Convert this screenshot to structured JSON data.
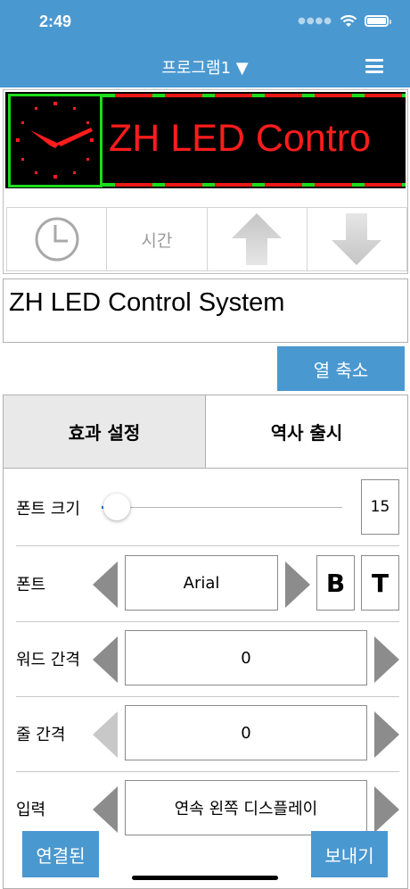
{
  "status_bar": {
    "time": "2:49",
    "signal_icon": "signal-dots-icon",
    "wifi_icon": "wifi-icon",
    "battery_icon": "battery-icon"
  },
  "nav": {
    "title": "프로그램1 ▼",
    "menu_icon": "hamburger-menu-icon"
  },
  "led_preview": {
    "text": "ZH LED Contro",
    "text_color": "#ff1c1c",
    "frame_color": "#1cdc1c"
  },
  "toolbar": {
    "clock_icon": "clock-icon",
    "time_label": "시간",
    "up_icon": "arrow-up-icon",
    "down_icon": "arrow-down-icon"
  },
  "text_input": {
    "value": "ZH LED Control System"
  },
  "compress_button": "열 축소",
  "tabs": [
    {
      "label": "효과 설정"
    },
    {
      "label": "역사 출시"
    }
  ],
  "settings": {
    "font_size": {
      "label": "폰트 크기",
      "value": "15",
      "slider_fraction": 0.05
    },
    "font": {
      "label": "폰트",
      "value": "Arial",
      "bold_label": "B",
      "text_label": "T"
    },
    "word_spacing": {
      "label": "워드 간격",
      "value": "0"
    },
    "line_spacing": {
      "label": "줄 간격",
      "value": "0"
    },
    "input": {
      "label": "입력",
      "value": "연속 왼쪽 디스플레이"
    }
  },
  "bottom": {
    "connect_label": "연결된",
    "send_label": "보내기"
  },
  "colors": {
    "accent": "#4a98d0"
  }
}
